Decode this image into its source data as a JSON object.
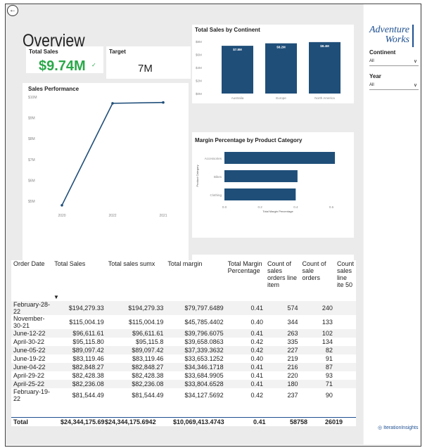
{
  "overview": {
    "title": "Overview"
  },
  "kpis": {
    "total_sales_label": "Total Sales",
    "total_sales_value": "$9.74M",
    "target_label": "Target",
    "target_value": "7M"
  },
  "sales_performance": {
    "title": "Sales Performance",
    "yticks": [
      "$10M",
      "$9M",
      "$8M",
      "$7M",
      "$6M",
      "$5M"
    ],
    "xticks": [
      "2020",
      "2022",
      "2021"
    ]
  },
  "continent_chart": {
    "title": "Total Sales by Continent",
    "yticks": [
      "$8M",
      "$6M",
      "$4M",
      "$2M",
      "$0M"
    ]
  },
  "margin_chart": {
    "title": "Margin Percentage by Product Category",
    "ylabel": "Product Category",
    "xlabel": "Total Margin Percentage",
    "xticks": [
      "0.0",
      "0.2",
      "0.4",
      "0.6"
    ]
  },
  "chart_data": [
    {
      "type": "line",
      "title": "Sales Performance",
      "x": [
        "2020",
        "2022",
        "2021"
      ],
      "values": [
        4.8,
        9.7,
        9.74
      ],
      "ylim": [
        5,
        10
      ]
    },
    {
      "type": "bar",
      "title": "Total Sales by Continent",
      "categories": [
        "Australia",
        "Europe",
        "North America"
      ],
      "values": [
        7.8,
        8.2,
        8.4
      ],
      "labels": [
        "$7.8M",
        "$8.2M",
        "$8.4M"
      ],
      "ylim": [
        0,
        8.5
      ]
    },
    {
      "type": "bar",
      "orientation": "horizontal",
      "title": "Margin Percentage by Product Category",
      "categories": [
        "Accessories",
        "Bikes",
        "Clothing"
      ],
      "values": [
        0.62,
        0.41,
        0.4
      ],
      "xlim": [
        0,
        0.6
      ]
    }
  ],
  "slicers": {
    "continent": {
      "label": "Continent",
      "value": "All"
    },
    "year": {
      "label": "Year",
      "value": "All"
    }
  },
  "logo": {
    "line1": "Adventure",
    "line2": "Works"
  },
  "table": {
    "headers": [
      "Order Date",
      "Total Sales",
      "Total sales sumx",
      "Total margin",
      "Total Margin Percentage",
      "Count of sales orders line item",
      "Count of sale orders",
      "Count sales line ite 50"
    ],
    "rows": [
      [
        "February-28-22",
        "$194,279.33",
        "$194,279.33",
        "$79,797.6489",
        "0.41",
        "574",
        "240"
      ],
      [
        "November-30-21",
        "$115,004.19",
        "$115,004.19",
        "$45,785.4402",
        "0.40",
        "344",
        "133"
      ],
      [
        "June-12-22",
        "$96,611.61",
        "$96,611.61",
        "$39,796.6075",
        "0.41",
        "263",
        "102"
      ],
      [
        "April-30-22",
        "$95,115.80",
        "$95,115.8",
        "$39,658.0863",
        "0.42",
        "335",
        "134"
      ],
      [
        "June-05-22",
        "$89,097.42",
        "$89,097.42",
        "$37,339.3632",
        "0.42",
        "227",
        "82"
      ],
      [
        "June-19-22",
        "$83,119.46",
        "$83,119.46",
        "$33,653.1252",
        "0.40",
        "219",
        "91"
      ],
      [
        "June-04-22",
        "$82,848.27",
        "$82,848.27",
        "$34,346.1718",
        "0.41",
        "216",
        "87"
      ],
      [
        "April-29-22",
        "$82,428.38",
        "$82,428.38",
        "$33,684.9905",
        "0.41",
        "220",
        "93"
      ],
      [
        "April-25-22",
        "$82,236.08",
        "$82,236.08",
        "$33,804.6528",
        "0.41",
        "180",
        "71"
      ],
      [
        "February-19-22",
        "$81,544.49",
        "$81,544.49",
        "$34,127.5692",
        "0.42",
        "237",
        "90"
      ]
    ],
    "total": [
      "Total",
      "$24,344,175.69",
      "$24,344,175.6942",
      "$10,069,413.4743",
      "0.41",
      "58758",
      "26019"
    ]
  },
  "brand_footer": "IterationInsights"
}
